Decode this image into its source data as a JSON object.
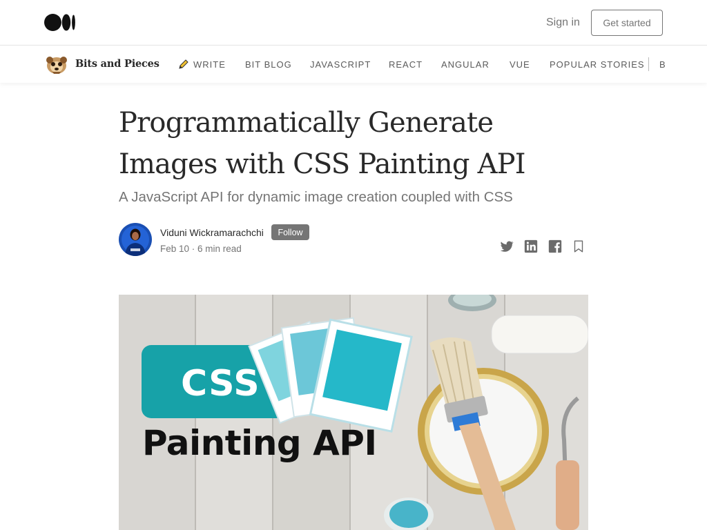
{
  "header": {
    "signin_label": "Sign in",
    "getstarted_label": "Get started",
    "logo_icon": "medium-logo-icon"
  },
  "publication": {
    "name": "Bits and Pieces",
    "logo_icon": "meerkat-logo-icon",
    "nav": [
      {
        "label": "WRITE",
        "icon": "pencil-icon"
      },
      {
        "label": "BIT BLOG"
      },
      {
        "label": "JAVASCRIPT"
      },
      {
        "label": "REACT"
      },
      {
        "label": "ANGULAR"
      },
      {
        "label": "VUE"
      },
      {
        "label": "POPULAR STORIES"
      },
      {
        "label": "B"
      }
    ]
  },
  "article": {
    "title": "Programmatically Generate Images with CSS Painting API",
    "subtitle": "A JavaScript API for dynamic image creation coupled with CSS",
    "author": "Viduni Wickramarachchi",
    "follow_label": "Follow",
    "meta": "Feb 10 · 6 min read",
    "share_icons": [
      "twitter-icon",
      "linkedin-icon",
      "facebook-icon",
      "bookmark-icon"
    ],
    "hero": {
      "css_label": "CSS",
      "painting_label": "Painting API",
      "accent_color": "#17a2a8"
    }
  },
  "colors": {
    "text": "#292929",
    "muted": "#757575",
    "border": "#e6e6e6",
    "teal": "#17a2a8"
  }
}
